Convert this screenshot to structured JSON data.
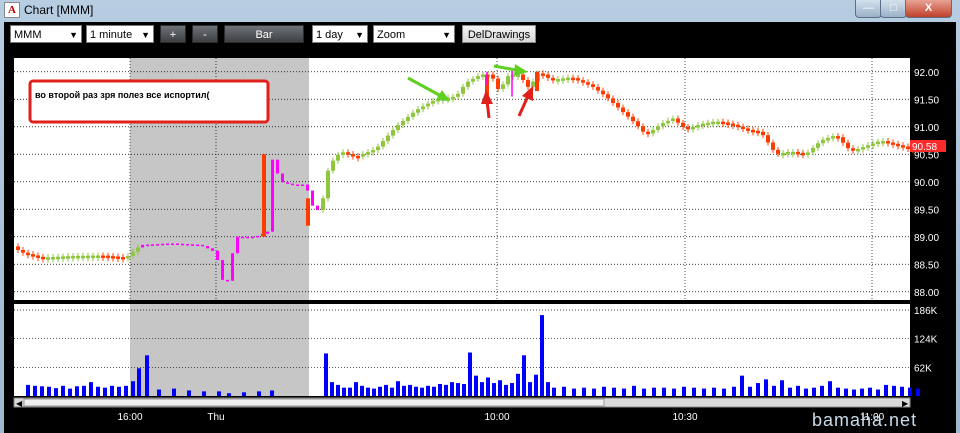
{
  "window": {
    "title": "Chart [MMM]",
    "app_icon_letter": "A",
    "min": "—",
    "max": "□",
    "close": "X"
  },
  "toolbar": {
    "symbol": "MMM",
    "interval": "1 minute",
    "zoom_in": "+",
    "zoom_out": "-",
    "chart_type": "Bar",
    "range": "1 day",
    "mode": "Zoom",
    "del_drawings": "DelDrawings"
  },
  "annotation": {
    "text": "во второй раз зря полез все испортил("
  },
  "watermark": "bamaha.net",
  "chart_data": {
    "type": "bar",
    "title": "",
    "price_axis": {
      "ticks": [
        92.0,
        91.5,
        91.0,
        90.5,
        90.0,
        89.5,
        89.0,
        88.5,
        88.0
      ],
      "ylim": [
        87.85,
        92.25
      ]
    },
    "last_price": "90.58",
    "volume_axis": {
      "ticks": [
        "186K",
        "124K",
        "62K"
      ]
    },
    "time_axis": {
      "ticks": [
        "16:00",
        "Thu",
        "10:00",
        "10:30",
        "11:00"
      ]
    },
    "colors": {
      "up": "#8ec63f",
      "down": "#ff3c00",
      "after_hours": "#ff00ff",
      "volume": "#0000ff",
      "grid": "#000000",
      "shade": "#c6c6c6",
      "price_badge": "#ff2a2a"
    },
    "price_path": [
      [
        0,
        88.85
      ],
      [
        10,
        88.72
      ],
      [
        30,
        88.62
      ],
      [
        60,
        88.65
      ],
      [
        90,
        88.66
      ],
      [
        115,
        88.62
      ],
      [
        130,
        88.85
      ],
      [
        160,
        88.88
      ],
      [
        190,
        88.85
      ],
      [
        205,
        88.72
      ],
      [
        215,
        88.0
      ],
      [
        225,
        89.0
      ],
      [
        245,
        89.0
      ],
      [
        258,
        89.1
      ],
      [
        262,
        90.4
      ],
      [
        270,
        90.0
      ],
      [
        280,
        89.95
      ],
      [
        295,
        89.95
      ],
      [
        305,
        89.4
      ],
      [
        312,
        89.7
      ],
      [
        318,
        90.3
      ],
      [
        330,
        90.55
      ],
      [
        345,
        90.45
      ],
      [
        365,
        90.6
      ],
      [
        385,
        91.0
      ],
      [
        405,
        91.3
      ],
      [
        425,
        91.5
      ],
      [
        445,
        91.55
      ],
      [
        455,
        91.8
      ],
      [
        470,
        91.95
      ],
      [
        480,
        91.95
      ],
      [
        488,
        91.65
      ],
      [
        498,
        91.95
      ],
      [
        508,
        91.95
      ],
      [
        518,
        91.7
      ],
      [
        528,
        92.0
      ],
      [
        540,
        91.85
      ],
      [
        560,
        91.9
      ],
      [
        580,
        91.75
      ],
      [
        595,
        91.55
      ],
      [
        610,
        91.3
      ],
      [
        625,
        91.05
      ],
      [
        635,
        90.85
      ],
      [
        650,
        91.05
      ],
      [
        662,
        91.15
      ],
      [
        675,
        90.95
      ],
      [
        690,
        91.05
      ],
      [
        705,
        91.1
      ],
      [
        720,
        91.05
      ],
      [
        735,
        90.95
      ],
      [
        750,
        90.9
      ],
      [
        765,
        90.5
      ],
      [
        780,
        90.55
      ],
      [
        795,
        90.5
      ],
      [
        810,
        90.75
      ],
      [
        825,
        90.85
      ],
      [
        840,
        90.55
      ],
      [
        855,
        90.65
      ],
      [
        870,
        90.75
      ],
      [
        890,
        90.65
      ],
      [
        905,
        90.58
      ]
    ],
    "volume_bars": [
      [
        14,
        24
      ],
      [
        21,
        22
      ],
      [
        28,
        21
      ],
      [
        35,
        20
      ],
      [
        42,
        17
      ],
      [
        49,
        22
      ],
      [
        56,
        16
      ],
      [
        63,
        21
      ],
      [
        70,
        22
      ],
      [
        77,
        30
      ],
      [
        84,
        20
      ],
      [
        91,
        18
      ],
      [
        98,
        22
      ],
      [
        105,
        20
      ],
      [
        112,
        22
      ],
      [
        119,
        32
      ],
      [
        125,
        60
      ],
      [
        133,
        88
      ],
      [
        145,
        14
      ],
      [
        160,
        16
      ],
      [
        175,
        12
      ],
      [
        190,
        10
      ],
      [
        205,
        10
      ],
      [
        215,
        6
      ],
      [
        230,
        8
      ],
      [
        245,
        10
      ],
      [
        258,
        12
      ],
      [
        312,
        92
      ],
      [
        318,
        30
      ],
      [
        324,
        24
      ],
      [
        330,
        18
      ],
      [
        336,
        18
      ],
      [
        342,
        30
      ],
      [
        348,
        22
      ],
      [
        354,
        18
      ],
      [
        360,
        16
      ],
      [
        366,
        20
      ],
      [
        372,
        24
      ],
      [
        378,
        18
      ],
      [
        384,
        32
      ],
      [
        390,
        22
      ],
      [
        396,
        24
      ],
      [
        402,
        20
      ],
      [
        408,
        18
      ],
      [
        414,
        22
      ],
      [
        420,
        20
      ],
      [
        426,
        26
      ],
      [
        432,
        24
      ],
      [
        438,
        30
      ],
      [
        444,
        28
      ],
      [
        450,
        26
      ],
      [
        456,
        94
      ],
      [
        462,
        44
      ],
      [
        468,
        30
      ],
      [
        474,
        40
      ],
      [
        480,
        28
      ],
      [
        486,
        34
      ],
      [
        492,
        24
      ],
      [
        498,
        28
      ],
      [
        504,
        48
      ],
      [
        510,
        88
      ],
      [
        516,
        30
      ],
      [
        522,
        46
      ],
      [
        528,
        175
      ],
      [
        534,
        30
      ],
      [
        540,
        18
      ],
      [
        550,
        20
      ],
      [
        560,
        16
      ],
      [
        570,
        18
      ],
      [
        580,
        16
      ],
      [
        590,
        20
      ],
      [
        600,
        18
      ],
      [
        610,
        16
      ],
      [
        620,
        22
      ],
      [
        630,
        16
      ],
      [
        640,
        18
      ],
      [
        650,
        18
      ],
      [
        660,
        16
      ],
      [
        670,
        20
      ],
      [
        680,
        18
      ],
      [
        690,
        16
      ],
      [
        700,
        18
      ],
      [
        710,
        16
      ],
      [
        720,
        20
      ],
      [
        728,
        44
      ],
      [
        736,
        20
      ],
      [
        744,
        28
      ],
      [
        752,
        36
      ],
      [
        760,
        22
      ],
      [
        768,
        34
      ],
      [
        776,
        18
      ],
      [
        784,
        22
      ],
      [
        792,
        16
      ],
      [
        800,
        18
      ],
      [
        808,
        22
      ],
      [
        816,
        32
      ],
      [
        824,
        18
      ],
      [
        832,
        16
      ],
      [
        840,
        14
      ],
      [
        848,
        16
      ],
      [
        856,
        18
      ],
      [
        864,
        14
      ],
      [
        872,
        24
      ],
      [
        880,
        22
      ],
      [
        888,
        20
      ],
      [
        896,
        18
      ],
      [
        904,
        16
      ]
    ]
  }
}
